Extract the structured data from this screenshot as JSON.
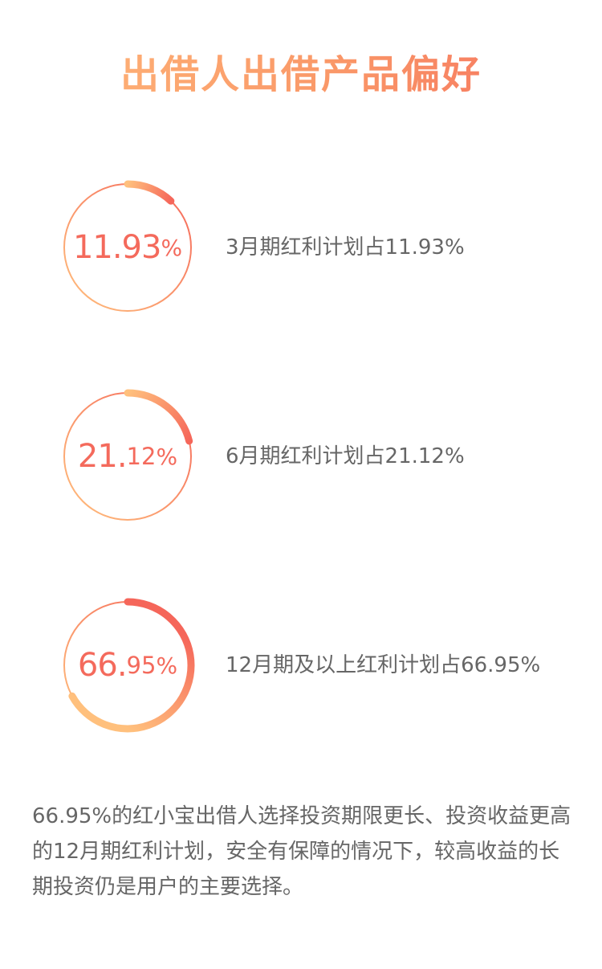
{
  "title": "出借人出借产品偏好",
  "colors": {
    "gradient_light": "#ffc07d",
    "gradient_dark": "#f5665a",
    "value_text": "#f46a5c",
    "body_text": "#666666"
  },
  "rings": [
    {
      "value_int": "11.93",
      "value_dec": "",
      "pct": "%",
      "label": "3月期红利计划占11.93%"
    },
    {
      "value_int": "21.",
      "value_dec": "12",
      "pct": "%",
      "label": "6月期红利计划占21.12%"
    },
    {
      "value_int": "66.",
      "value_dec": "95",
      "pct": "%",
      "label": "12月期及以上红利计划占66.95%"
    }
  ],
  "summary": "66.95%的红小宝出借人选择投资期限更长、投资收益更高的12月期红利计划，安全有保障的情况下，较高收益的长期投资仍是用户的主要选择。",
  "chart_data": {
    "type": "pie",
    "categories": [
      "3月期红利计划",
      "6月期红利计划",
      "12月期及以上红利计划"
    ],
    "values": [
      11.93,
      21.12,
      66.95
    ],
    "unit": "%",
    "title": "出借人出借产品偏好"
  }
}
